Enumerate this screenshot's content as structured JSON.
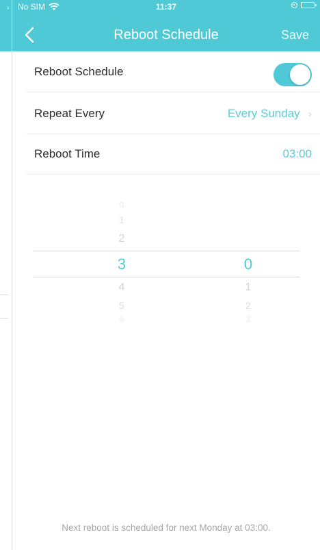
{
  "status_bar": {
    "carrier": "No SIM",
    "time": "11:37"
  },
  "nav": {
    "title": "Reboot Schedule",
    "save_label": "Save"
  },
  "settings": {
    "reboot_schedule": {
      "label": "Reboot Schedule",
      "enabled": true
    },
    "repeat_every": {
      "label": "Repeat Every",
      "value": "Every Sunday"
    },
    "reboot_time": {
      "label": "Reboot Time",
      "value": "03:00"
    }
  },
  "picker": {
    "hours": [
      "0",
      "1",
      "2",
      "3",
      "4",
      "5",
      "6"
    ],
    "hours_selected": "3",
    "minutes": [
      "0",
      "1",
      "2",
      "3"
    ],
    "minutes_selected": "0"
  },
  "footer": {
    "note": "Next reboot is scheduled for next Monday at 03:00."
  },
  "colors": {
    "accent": "#4fc9d6",
    "value_text": "#5dcbd8"
  }
}
